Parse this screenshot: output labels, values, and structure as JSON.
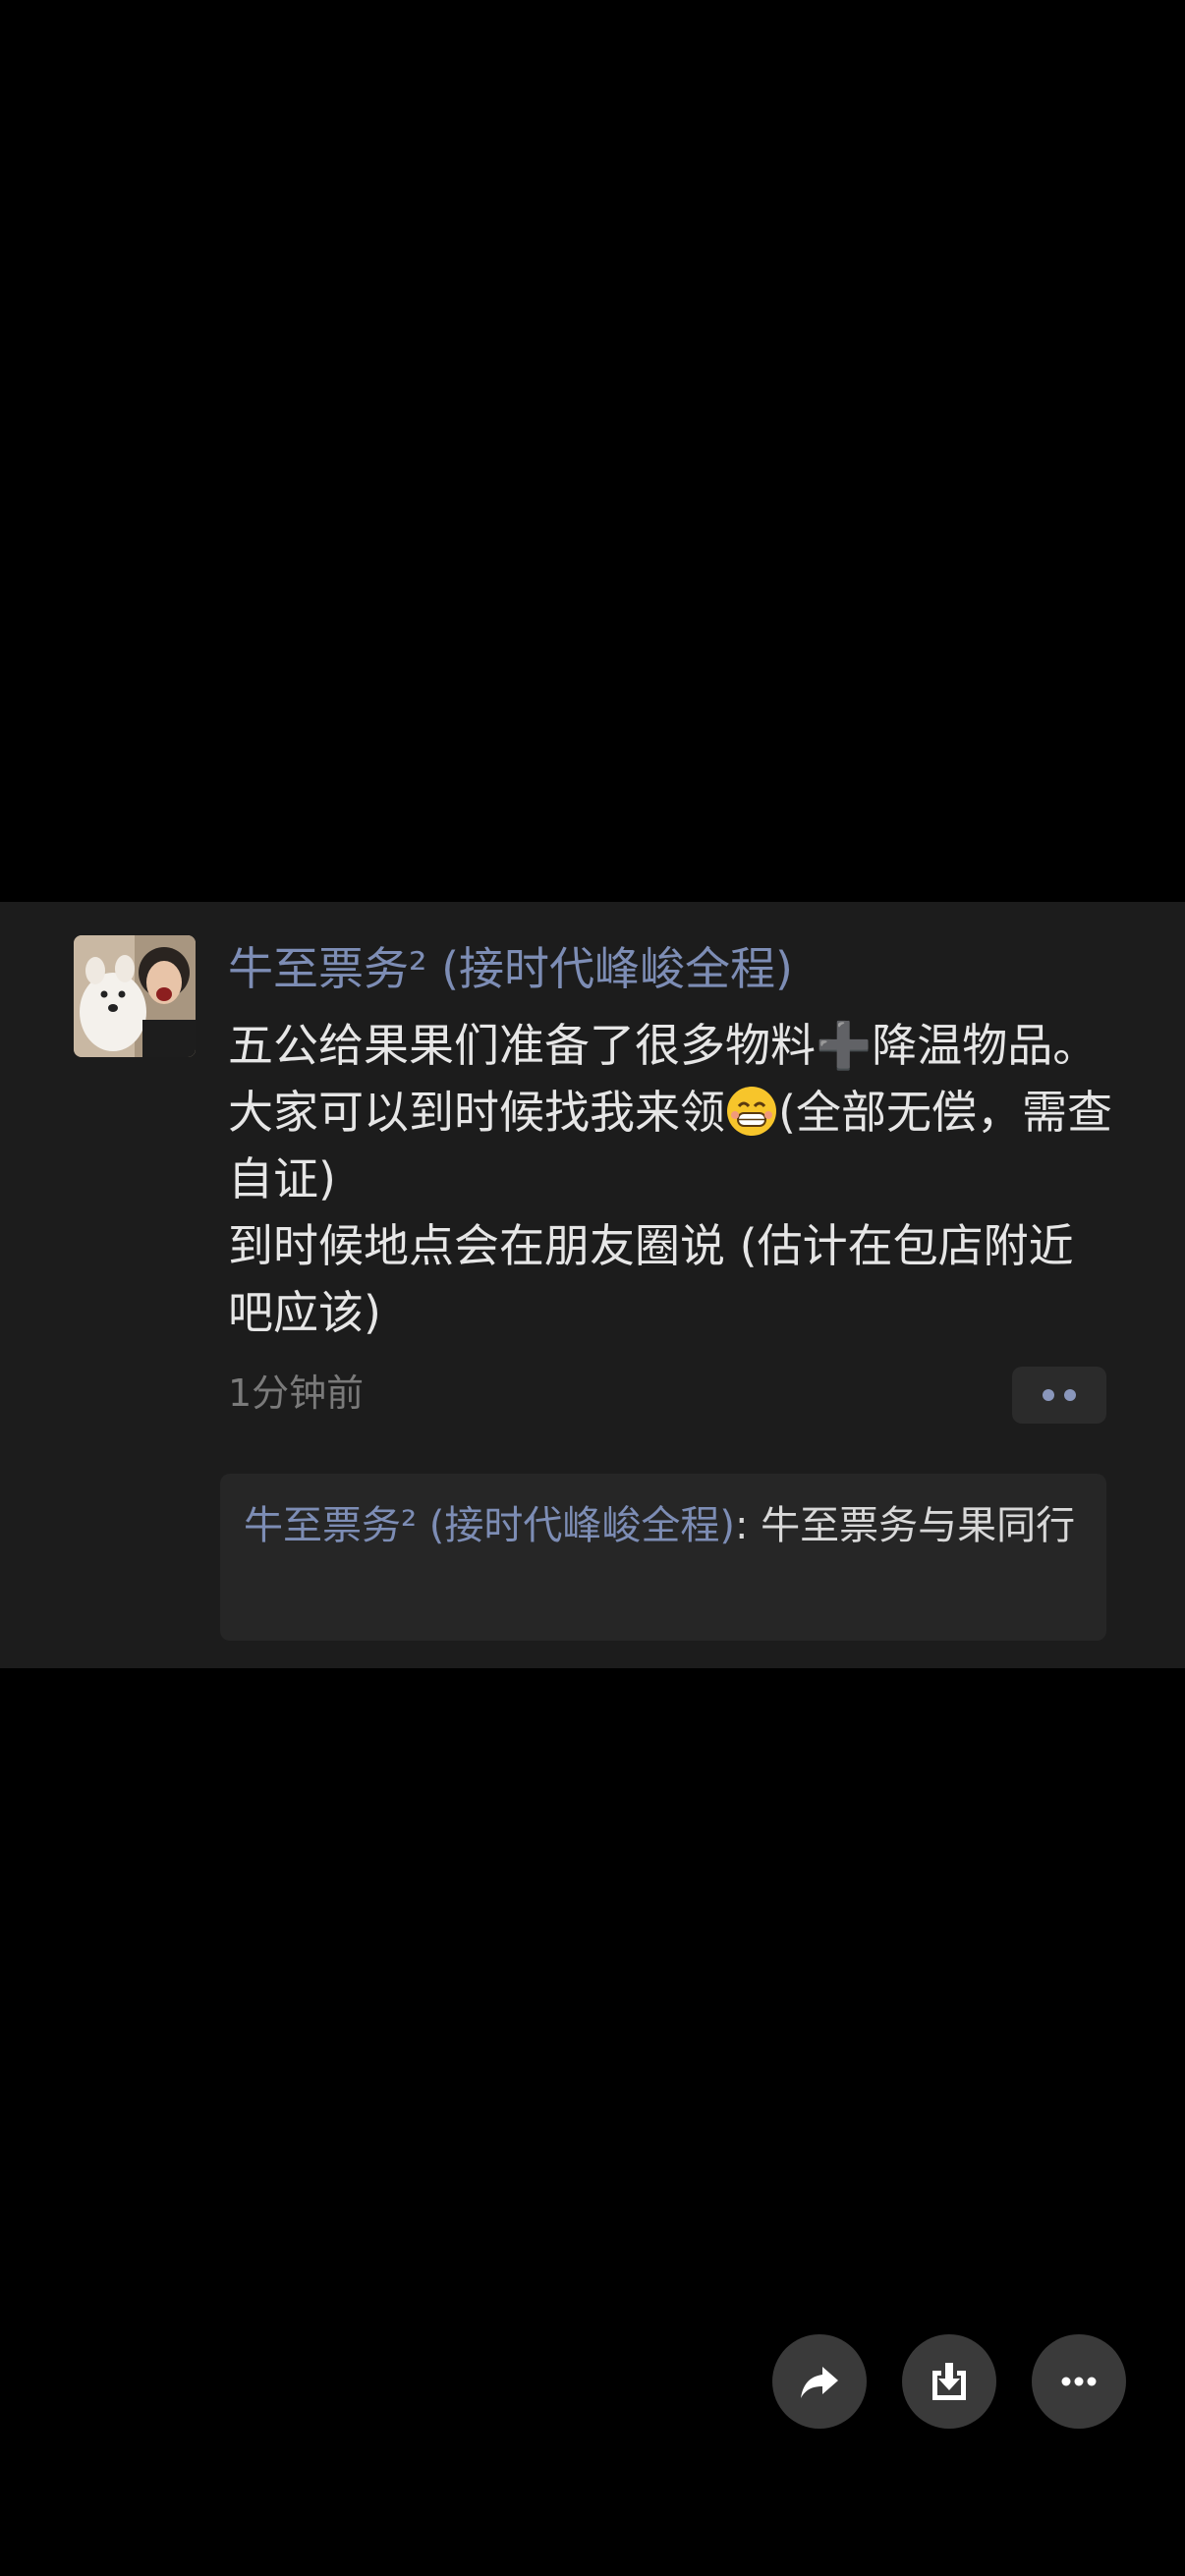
{
  "post": {
    "author": "牛至票务² (接时代峰峻全程)",
    "lines": [
      "五公给果果们准备了很多物料➕降温物品。大家可以到时候找我来领",
      "(全部无偿，需查自证)",
      "到时候地点会在朋友圈说 (估计在包店附近吧应该)"
    ],
    "emoji_name": "grinning-face-with-smiling-eyes-emoji",
    "timestamp": "1分钟前"
  },
  "comment": {
    "author": "牛至票务² (接时代峰峻全程)",
    "separator": ": ",
    "text": "牛至票务与果同行"
  },
  "icons": {
    "share": "share-arrow-icon",
    "download": "download-icon",
    "more": "more-horizontal-icon",
    "post_menu": "more-dots-icon"
  },
  "colors": {
    "background": "#000000",
    "card": "#1c1c1c",
    "name_accent": "#7d8db5",
    "text": "#e6e6e6",
    "muted": "#7a7a7a"
  }
}
